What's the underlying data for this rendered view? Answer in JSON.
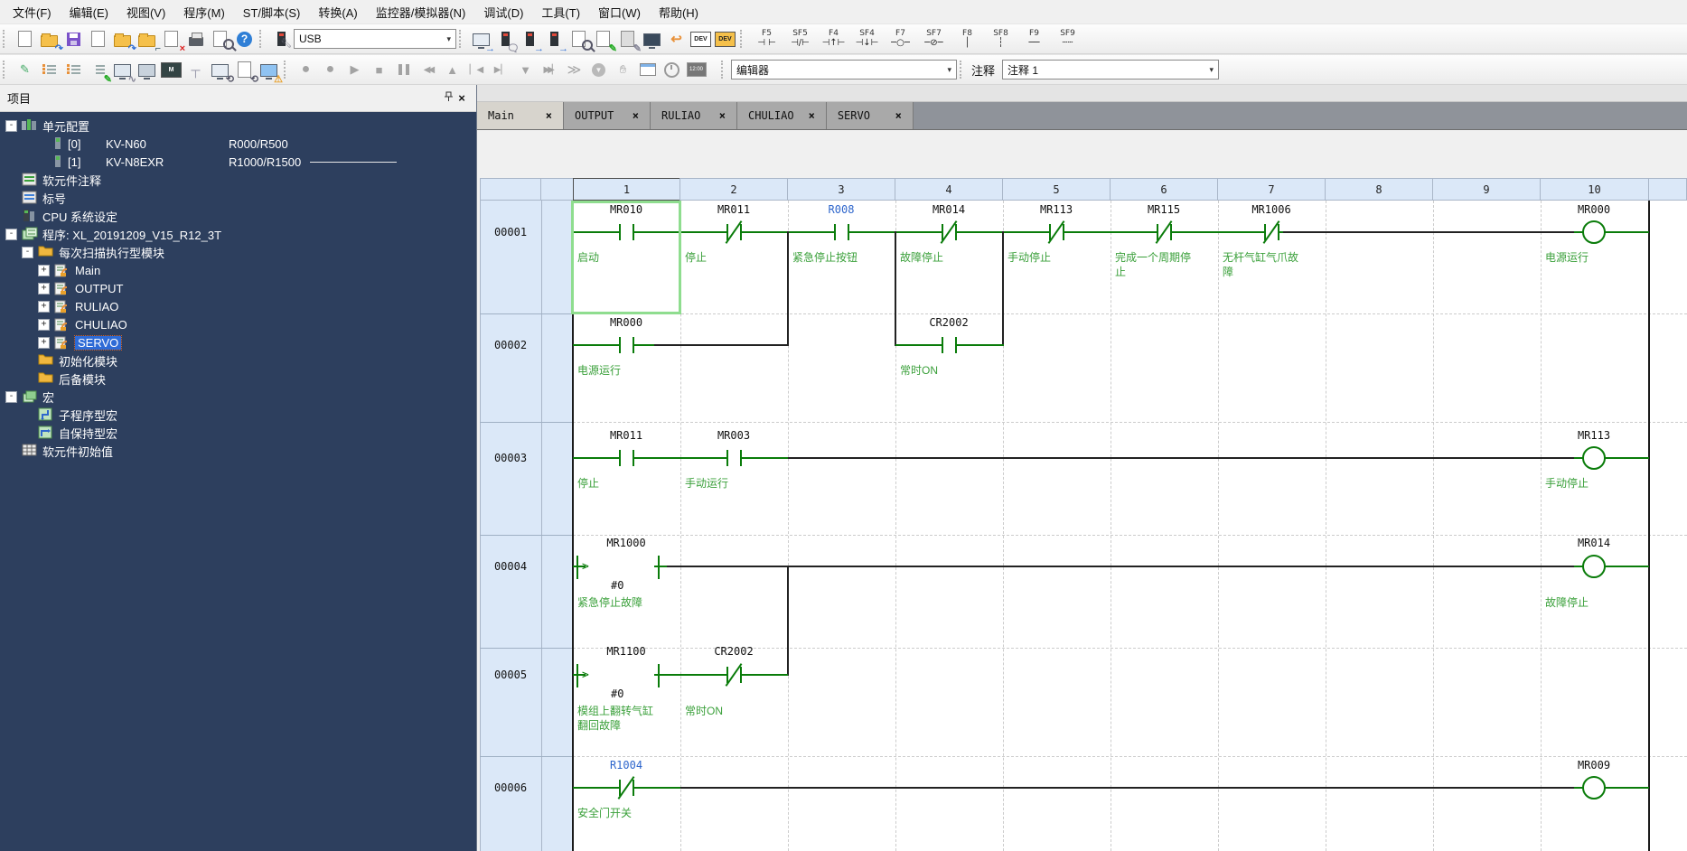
{
  "menu": {
    "items": [
      "文件(F)",
      "编辑(E)",
      "视图(V)",
      "程序(M)",
      "ST/脚本(S)",
      "转换(A)",
      "监控器/模拟器(N)",
      "调试(D)",
      "工具(T)",
      "窗口(W)",
      "帮助(H)"
    ]
  },
  "icons": {
    "dropdown": "▾",
    "close": "×",
    "pin": "-□",
    "help": "?",
    "record": "●",
    "record2": "●",
    "play": "▶",
    "stop": "■",
    "rewind": "◀◀",
    "up": "▲",
    "step_back": "▏◀",
    "step_forward": "▶▏",
    "down": "▼",
    "fast_forward": "▶▶▏",
    "continue": "≫",
    "download": "▼",
    "dev": "DEV",
    "clock": "12:00",
    "arrow_in": "→",
    "arrow_out": "←",
    "arrow_run": "➔"
  },
  "toolbar1": {
    "usb": "USB",
    "fkeys": [
      {
        "key": "F5",
        "glyph": "⊣ ⊢"
      },
      {
        "key": "SF5",
        "glyph": "⊣/⊢"
      },
      {
        "key": "F4",
        "glyph": "⊣↑⊢"
      },
      {
        "key": "SF4",
        "glyph": "⊣↓⊢"
      },
      {
        "key": "F7",
        "glyph": "─○─"
      },
      {
        "key": "SF7",
        "glyph": "─⊘─"
      },
      {
        "key": "F8",
        "glyph": "│"
      },
      {
        "key": "SF8",
        "glyph": "┆"
      },
      {
        "key": "F9",
        "glyph": "──"
      },
      {
        "key": "SF9",
        "glyph": "┄┄"
      }
    ]
  },
  "toolbar2": {
    "editor": "编辑器",
    "comment_label": "注释",
    "comment_value": "注释 1"
  },
  "panel": {
    "title": "项目"
  },
  "tree": {
    "items": [
      {
        "label": "单元配置"
      },
      {
        "idx": "[0]",
        "name": "KV-N60",
        "detail": "R000/R500"
      },
      {
        "idx": "[1]",
        "name": "KV-N8EXR",
        "detail": "R1000/R1500"
      },
      {
        "label": "软元件注释"
      },
      {
        "label": "标号"
      },
      {
        "label": "CPU 系统设定"
      },
      {
        "label": "程序: XL_20191209_V15_R12_3T"
      },
      {
        "label": "每次扫描执行型模块"
      },
      {
        "label": "Main"
      },
      {
        "label": "OUTPUT"
      },
      {
        "label": "RULIAO"
      },
      {
        "label": "CHULIAO"
      },
      {
        "label": "SERVO"
      },
      {
        "label": "初始化模块"
      },
      {
        "label": "后备模块"
      },
      {
        "label": "宏"
      },
      {
        "label": "子程序型宏"
      },
      {
        "label": "自保持型宏"
      },
      {
        "label": "软元件初始值"
      }
    ]
  },
  "tabs": [
    {
      "label": "Main"
    },
    {
      "label": "OUTPUT"
    },
    {
      "label": "RULIAO"
    },
    {
      "label": "CHULIAO"
    },
    {
      "label": "SERVO"
    }
  ],
  "ladder": {
    "columns": [
      "1",
      "2",
      "3",
      "4",
      "5",
      "6",
      "7",
      "8",
      "9",
      "10"
    ],
    "rungs": [
      {
        "number": "00001",
        "cells": [
          {
            "device": "MR010",
            "comment": "启动"
          },
          {
            "device": "MR011",
            "comment": "停止"
          },
          {
            "device": "R008",
            "comment": "紧急停止按钮"
          },
          {
            "device": "MR014",
            "comment": "故障停止"
          },
          {
            "device": "MR113",
            "comment": "手动停止"
          },
          {
            "device": "MR115",
            "comment": "完成一个周期停止"
          },
          {
            "device": "MR1006",
            "comment": "无杆气缸气爪故障"
          }
        ],
        "coil": {
          "device": "MR000",
          "comment": "电源运行"
        }
      },
      {
        "number": "00002",
        "cells": [
          {
            "device": "MR000",
            "comment": "电源运行"
          },
          {
            "device": "CR2002",
            "comment": "常时ON"
          }
        ]
      },
      {
        "number": "00003",
        "cells": [
          {
            "device": "MR011",
            "comment": "停止"
          },
          {
            "device": "MR003",
            "comment": "手动运行"
          }
        ],
        "coil": {
          "device": "MR113",
          "comment": "手动停止"
        }
      },
      {
        "number": "00004",
        "cells": [
          {
            "device": "MR1000",
            "operand": "#0",
            "comment": "紧急停止故障"
          }
        ],
        "coil": {
          "device": "MR014",
          "comment": "故障停止"
        }
      },
      {
        "number": "00005",
        "cells": [
          {
            "device": "MR1100",
            "operand": "#0",
            "comment": "模组上翻转气缸翻回故障"
          },
          {
            "device": "CR2002",
            "comment": "常时ON"
          }
        ]
      },
      {
        "number": "00006",
        "cells": [
          {
            "device": "R1004",
            "comment": "安全门开关"
          }
        ],
        "coil": {
          "device": "MR009"
        }
      }
    ]
  }
}
